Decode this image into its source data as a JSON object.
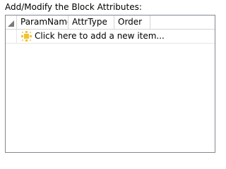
{
  "panel": {
    "caption": "Add/Modify the Block Attributes:"
  },
  "grid": {
    "columns": [
      {
        "label": "ParamName"
      },
      {
        "label": "AttrType"
      },
      {
        "label": "Order"
      }
    ],
    "new_row": {
      "icon": "sparkle-new-item-icon",
      "label": "Click here to add a new item..."
    }
  },
  "colors": {
    "grid_border": "#828790",
    "gridline": "#d5d5d5",
    "icon_yellow": "#f2c12e"
  }
}
